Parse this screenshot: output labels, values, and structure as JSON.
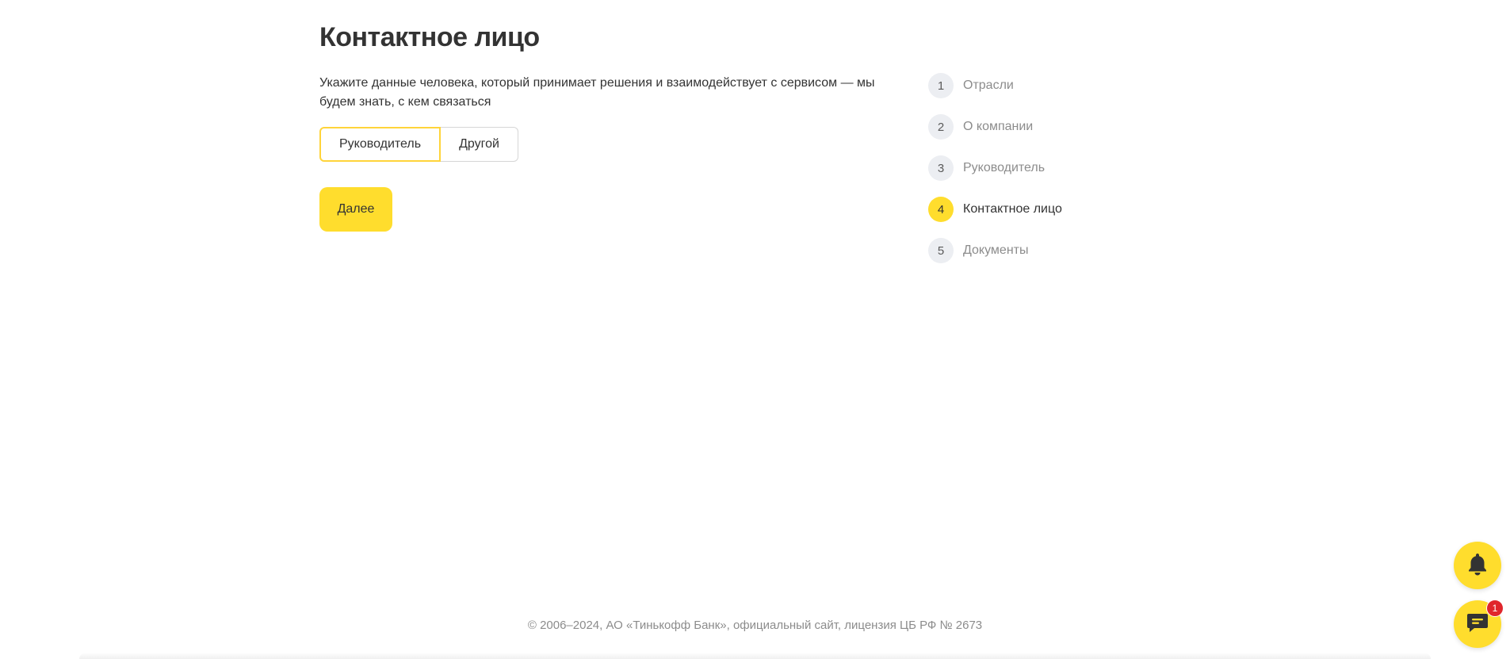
{
  "page": {
    "title": "Контактное лицо",
    "description": "Укажите данные человека, который принимает решения и взаимодействует с сервисом — мы будем знать, с кем связаться"
  },
  "contact_type": {
    "options": [
      "Руководитель",
      "Другой"
    ],
    "selected": "Руководитель"
  },
  "actions": {
    "next_label": "Далее"
  },
  "steps": [
    {
      "number": "1",
      "label": "Отрасли"
    },
    {
      "number": "2",
      "label": "О компании"
    },
    {
      "number": "3",
      "label": "Руководитель"
    },
    {
      "number": "4",
      "label": "Контактное лицо"
    },
    {
      "number": "5",
      "label": "Документы"
    }
  ],
  "current_step": "4",
  "footer": {
    "copyright": "© 2006–2024, АО «Тинькофф Банк», официальный сайт, лицензия ЦБ РФ № 2673"
  },
  "widgets": {
    "notifications_icon": "bell-icon",
    "chat_icon": "chat-icon",
    "chat_badge_count": "1"
  },
  "colors": {
    "accent": "#ffdd2d",
    "badge": "#e0262c",
    "text": "#333333",
    "muted": "#8c8c8c"
  }
}
